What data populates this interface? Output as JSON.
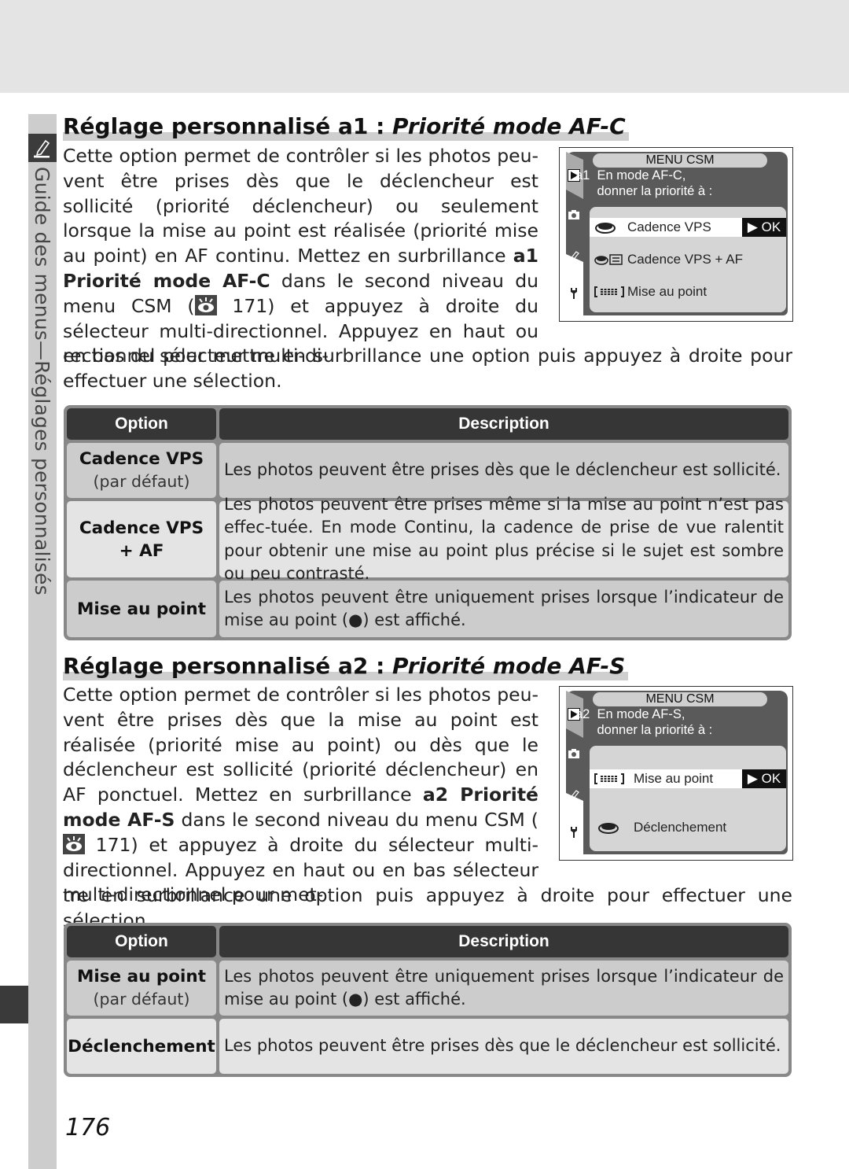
{
  "sidebar": {
    "label_part1": "Guide des menus",
    "label_dash": "—",
    "label_part2": "Réglages personnalisés",
    "icon": "pencil-icon"
  },
  "section_a1": {
    "title_prefix": "Réglage personnalisé a1 : ",
    "title_italic": "Priorité mode AF-C",
    "para_narrow": [
      "Cette option permet de contrôler si les photos peu-vent être prises dès que le déclencheur est sollicité (priorité déclencheur) ou seulement lorsque la mise au point est réalisée (priorité mise au point) en AF continu. Mettez en surbrillance ",
      "a1 Priorité mode AF-C",
      " dans le second niveau du menu CSM (",
      " 171) et appuyez à droite du sélecteur multi-directionnel. Appuyez en haut ou en bas du sélecteur multi-di-"
    ],
    "para_wide": "rectionnel pour mettre en surbrillance une option puis appuyez à droite pour effectuer une sélection.",
    "screen": {
      "title": "MENU CSM",
      "heading_line1": "a1  En mode AF-C,",
      "heading_line2": "      donner la priorité à :",
      "items": [
        {
          "label": "Cadence VPS",
          "icon": "release-button-icon",
          "selected": true
        },
        {
          "label": "Cadence VPS + AF",
          "icon": "release-focus-icon",
          "selected": false
        },
        {
          "label": "Mise au point",
          "icon": "focus-area-icon",
          "selected": false
        }
      ],
      "ok_label": "▶ OK"
    },
    "table": {
      "headers": [
        "Option",
        "Description"
      ],
      "rows": [
        {
          "option": "Cadence VPS",
          "note": "(par défaut)",
          "description": "Les photos peuvent être prises dès que le déclencheur est sollicité."
        },
        {
          "option": "Cadence VPS",
          "option2": "+ AF",
          "description": "Les photos peuvent être prises même si la mise au point n’est pas effec-tuée. En mode Continu, la cadence de prise de vue ralentit pour obtenir une mise au point plus précise si le sujet est sombre ou peu contrasté."
        },
        {
          "option": "Mise au point",
          "description": "Les photos peuvent être uniquement prises lorsque l’indicateur de mise au point (●) est affiché."
        }
      ]
    }
  },
  "section_a2": {
    "title_prefix": "Réglage personnalisé a2 : ",
    "title_italic": "Priorité mode AF-S",
    "para_narrow": [
      "Cette option permet de contrôler si les photos peu-vent être prises dès que la mise au point est réalisée (priorité mise au point) ou dès que le déclencheur est sollicité (priorité déclencheur) en AF ponctuel. Mettez en surbrillance ",
      "a2 Priorité mode AF-S",
      " dans le second niveau du menu CSM (",
      " 171) et appuyez à droite du sélecteur multi-directionnel. Appuyez en haut ou en bas sélecteur multi-directionnel pour met-"
    ],
    "para_wide": "tre en surbrillance une option puis appuyez à droite pour effectuer une sélection.",
    "screen": {
      "title": "MENU CSM",
      "heading_line1": "a2  En mode AF-S,",
      "heading_line2": "      donner la priorité à :",
      "items": [
        {
          "label": "Mise au point",
          "icon": "focus-area-icon",
          "selected": true
        },
        {
          "label": "Déclenchement",
          "icon": "release-button-icon",
          "selected": false
        }
      ],
      "ok_label": "▶ OK"
    },
    "table": {
      "headers": [
        "Option",
        "Description"
      ],
      "rows": [
        {
          "option": "Mise au point",
          "note": "(par défaut)",
          "description": "Les photos peuvent être uniquement prises lorsque l’indicateur de mise au point (●) est affiché."
        },
        {
          "option": "Déclenchement",
          "description": "Les photos peuvent être prises dès que le déclencheur est sollicité."
        }
      ]
    }
  },
  "page_number": "176"
}
